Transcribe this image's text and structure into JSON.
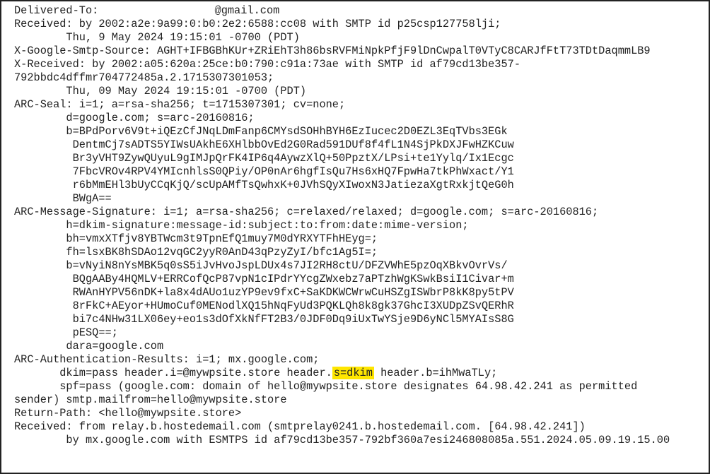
{
  "headers": {
    "delivered_to_prefix": "Delivered-To: ",
    "delivered_to_suffix": "@gmail.com",
    "received1_l1": "Received: by 2002:a2e:9a99:0:b0:2e2:6588:cc08 with SMTP id p25csp127758lji;",
    "received1_l2": "        Thu, 9 May 2024 19:15:01 -0700 (PDT)",
    "x_google_smtp_source": "X-Google-Smtp-Source: AGHT+IFBGBhKUr+ZRiEhT3h86bsRVFMiNpkPfjF9lDnCwpalT0VTyC8CARJfFtT73TDtDaqmmLB9",
    "x_received_l1": "X-Received: by 2002:a05:620a:25ce:b0:790:c91a:73ae with SMTP id af79cd13be357-",
    "x_received_l2": "792bbdc4dffmr704772485a.2.1715307301053;",
    "x_received_l3": "        Thu, 09 May 2024 19:15:01 -0700 (PDT)",
    "arc_seal_l1": "ARC-Seal: i=1; a=rsa-sha256; t=1715307301; cv=none;",
    "arc_seal_l2": "        d=google.com; s=arc-20160816;",
    "arc_seal_l3": "        b=BPdPorv6V9t+iQEzCfJNqLDmFanp6CMYsdSOHhBYH6EzIucec2D0EZL3EqTVbs3EGk",
    "arc_seal_l4": "         DentmCj7sADTS5YIWsUAkhE6XHlbbOvEd2G0Rad591DUf8f4fL1N4SjPkDXJFwHZKCuw",
    "arc_seal_l5": "         Br3yVHT9ZywQUyuL9gIMJpQrFK4IP6q4AywzXlQ+50PpztX/LPsi+te1Yylq/Ix1Ecgc",
    "arc_seal_l6": "         7FbcVROv4RPV4YMIcnhlsS0QPiy/OP0nAr6hgfIsQu7Hs6xHQ7FpwHa7tkPhWxact/Y1",
    "arc_seal_l7": "         r6bMmEHl3bUyCCqKjQ/scUpAMfTsQwhxK+0JVhSQyXIwoxN3JatiezaXgtRxkjtQeG0h",
    "arc_seal_l8": "         BWgA==",
    "arc_msg_sig_l1": "ARC-Message-Signature: i=1; a=rsa-sha256; c=relaxed/relaxed; d=google.com; s=arc-20160816;",
    "arc_msg_sig_l2": "        h=dkim-signature:message-id:subject:to:from:date:mime-version;",
    "arc_msg_sig_l3": "        bh=vmxXTfjv8YBTWcm3t9TpnEfQ1muy7M0dYRXYTFhHEyg=;",
    "arc_msg_sig_l4": "        fh=lsxBK8hSDAo12vqGC2yyR0AnD43qPzyZyI/bfc1Ag5I=;",
    "arc_msg_sig_l5": "        b=vNyiN8nYsMBK5q0sS5iJvHvoJspLDUx4s7JI2RH8ctU/DFZVWhE5pzOqXBkvOvrVs/",
    "arc_msg_sig_l6": "         BQgAABy4HQMLV+ERRCofQcP87vpN1cIPdrYYcgZWxebz7aPTzhWgKSwkBsiI1Civar+m",
    "arc_msg_sig_l7": "         RWAnHYPV56nDK+la8x4dAUo1uzYP9ev9fxC+SaKDKWCWrwCuHSZgISWbrP8kK8py5tPV",
    "arc_msg_sig_l8": "         8rFkC+AEyor+HUmoCuf0MENodlXQ15hNqFyUd3PQKLQh8k8gk37GhcI3XUDpZSvQERhR",
    "arc_msg_sig_l9": "         bi7c4NHw31LX06ey+eo1s3dOfXkNfFT2B3/0JDF0Dq9iUxTwYSje9D6yNCl5MYAIsS8G",
    "arc_msg_sig_l10": "         pESQ==;",
    "arc_msg_sig_l11": "        dara=google.com",
    "arc_auth_l1": "ARC-Authentication-Results: i=1; mx.google.com;",
    "arc_auth_l2_pre": "       dkim=pass header.i=@mywpsite.store header.",
    "arc_auth_l2_hl": "s=dkim",
    "arc_auth_l2_post": " header.b=ihMwaTLy;",
    "arc_auth_l3": "       spf=pass (google.com: domain of hello@mywpsite.store designates 64.98.42.241 as permitted ",
    "arc_auth_l4": "sender) smtp.mailfrom=hello@mywpsite.store",
    "return_path": "Return-Path: <hello@mywpsite.store>",
    "received2_l1": "Received: from relay.b.hostedemail.com (smtprelay0241.b.hostedemail.com. [64.98.42.241])",
    "received2_l2": "        by mx.google.com with ESMTPS id af79cd13be357-792bf360a7esi246808085a.551.2024.05.09.19.15.00"
  }
}
